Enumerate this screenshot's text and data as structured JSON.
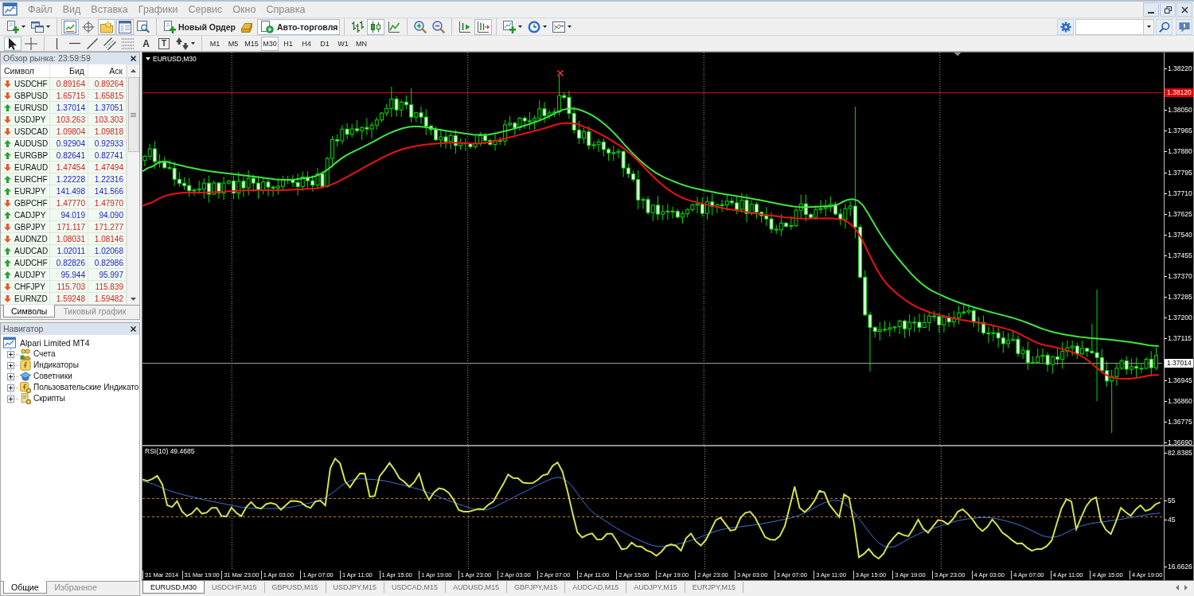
{
  "menu_bar": {
    "items": [
      "Файл",
      "Вид",
      "Вставка",
      "Графики",
      "Сервис",
      "Окно",
      "Справка"
    ]
  },
  "toolbar": {
    "groups": [
      [
        {
          "pressed": false,
          "dropdown": true
        },
        {
          "pressed": false,
          "dropdown": true
        }
      ],
      [
        {
          "pressed": true
        },
        {
          "pressed": false
        },
        {
          "pressed": true
        },
        {
          "pressed": true
        },
        {
          "pressed": false
        }
      ],
      [
        {
          "label": "Новый Ордер",
          "pressed": false
        },
        {
          "pressed": false
        },
        {
          "label": "Авто-торговля",
          "pressed": true
        }
      ],
      [
        {
          "pressed": false
        },
        {
          "pressed": true
        },
        {
          "pressed": false
        }
      ],
      [
        {
          "pressed": false
        },
        {
          "pressed": false
        }
      ],
      [
        {
          "pressed": false
        },
        {
          "pressed": true
        }
      ],
      [
        {
          "pressed": false,
          "dropdown": true
        },
        {
          "pressed": false,
          "dropdown": true
        },
        {
          "pressed": false,
          "dropdown": true
        }
      ]
    ]
  },
  "drawing_toolbar": {
    "groups": [
      [
        {
          "pressed": true
        },
        {
          "pressed": false
        }
      ],
      [
        {
          "pressed": false
        },
        {
          "pressed": false
        },
        {
          "pressed": false
        },
        {
          "pressed": false
        },
        {
          "pressed": false
        },
        {
          "label": "A",
          "pressed": false
        },
        {
          "label": "T",
          "pressed": false
        },
        {
          "pressed": false,
          "dropdown": true
        }
      ]
    ]
  },
  "periods": [
    {
      "label": "M1",
      "selected": false
    },
    {
      "label": "M5",
      "selected": false
    },
    {
      "label": "M15",
      "selected": false
    },
    {
      "label": "M30",
      "selected": true
    },
    {
      "label": "H1",
      "selected": false
    },
    {
      "label": "H4",
      "selected": false
    },
    {
      "label": "D1",
      "selected": false
    },
    {
      "label": "W1",
      "selected": false
    },
    {
      "label": "MN",
      "selected": false
    }
  ],
  "market_watch": {
    "title": "Обзор рынка: 23:59:59",
    "columns": [
      "Символ",
      "Бид",
      "Аск"
    ],
    "rows": [
      {
        "symbol": "USDCHF",
        "bid": "0.89164",
        "ask": "0.89264",
        "rising": false
      },
      {
        "symbol": "GBPUSD",
        "bid": "1.65715",
        "ask": "1.65815",
        "rising": false
      },
      {
        "symbol": "EURUSD",
        "bid": "1.37014",
        "ask": "1.37051",
        "rising": true
      },
      {
        "symbol": "USDJPY",
        "bid": "103.263",
        "ask": "103.303",
        "rising": false
      },
      {
        "symbol": "USDCAD",
        "bid": "1.09804",
        "ask": "1.09818",
        "rising": false
      },
      {
        "symbol": "AUDUSD",
        "bid": "0.92904",
        "ask": "0.92933",
        "rising": true
      },
      {
        "symbol": "EURGBP",
        "bid": "0.82641",
        "ask": "0.82741",
        "rising": true
      },
      {
        "symbol": "EURAUD",
        "bid": "1.47454",
        "ask": "1.47494",
        "rising": false
      },
      {
        "symbol": "EURCHF",
        "bid": "1.22228",
        "ask": "1.22316",
        "rising": true
      },
      {
        "symbol": "EURJPY",
        "bid": "141.498",
        "ask": "141.566",
        "rising": true
      },
      {
        "symbol": "GBPCHF",
        "bid": "1.47770",
        "ask": "1.47970",
        "rising": false
      },
      {
        "symbol": "CADJPY",
        "bid": "94.019",
        "ask": "94.090",
        "rising": true
      },
      {
        "symbol": "GBPJPY",
        "bid": "171.117",
        "ask": "171.277",
        "rising": false
      },
      {
        "symbol": "AUDNZD",
        "bid": "1.08031",
        "ask": "1.08146",
        "rising": false
      },
      {
        "symbol": "AUDCAD",
        "bid": "1.02011",
        "ask": "1.02068",
        "rising": true
      },
      {
        "symbol": "AUDCHF",
        "bid": "0.82826",
        "ask": "0.82986",
        "rising": true
      },
      {
        "symbol": "AUDJPY",
        "bid": "95.944",
        "ask": "95.997",
        "rising": true
      },
      {
        "symbol": "CHFJPY",
        "bid": "115.703",
        "ask": "115.839",
        "rising": false
      },
      {
        "symbol": "EURNZD",
        "bid": "1.59248",
        "ask": "1.59482",
        "rising": false
      }
    ],
    "tabs": [
      {
        "label": "Символы",
        "selected": true
      },
      {
        "label": "Тиковый график",
        "selected": false
      }
    ]
  },
  "navigator": {
    "title": "Навигатор",
    "tree": [
      {
        "label": "Alpari Limited MT4",
        "children": [
          {
            "label": "Счета",
            "expanded": false
          },
          {
            "label": "Индикаторы",
            "expanded": false
          },
          {
            "label": "Советники",
            "expanded": false
          },
          {
            "label": "Пользовательские Индикато",
            "expanded": false
          },
          {
            "label": "Скрипты",
            "expanded": false
          }
        ]
      }
    ],
    "tabs": [
      {
        "label": "Общие",
        "selected": true
      },
      {
        "label": "Избранное",
        "selected": false
      }
    ]
  },
  "chart": {
    "title": "EURUSD,M30",
    "price_axis": [
      "1.38220",
      "1.38050",
      "1.37965",
      "1.37880",
      "1.37795",
      "1.37710",
      "1.37625",
      "1.37540",
      "1.37455",
      "1.37370",
      "1.37285",
      "1.37200",
      "1.37115",
      "1.36945",
      "1.36860",
      "1.36775",
      "1.36690"
    ],
    "alert_price": "1.38120",
    "bid_price": "1.37014",
    "indicator": {
      "title": "RSI(10) 49.4685",
      "axis": [
        "82.8385",
        "55",
        "45",
        "16.6626"
      ]
    },
    "time_axis": [
      "31 Mar 2014",
      "31 Mar 19:00",
      "31 Mar 23:00",
      "1 Apr 03:00",
      "1 Apr 07:00",
      "1 Apr 11:00",
      "1 Apr 15:00",
      "1 Apr 19:00",
      "1 Apr 23:00",
      "2 Apr 03:00",
      "2 Apr 07:00",
      "2 Apr 11:00",
      "2 Apr 15:00",
      "2 Apr 19:00",
      "2 Apr 23:00",
      "3 Apr 03:00",
      "3 Apr 07:00",
      "3 Apr 11:00",
      "3 Apr 15:00",
      "3 Apr 19:00",
      "3 Apr 23:00",
      "4 Apr 03:00",
      "4 Apr 07:00",
      "4 Apr 11:00",
      "4 Apr 15:00",
      "4 Apr 19:00"
    ]
  },
  "chart_tabs": [
    {
      "label": "EURUSD,M30",
      "selected": true
    },
    {
      "label": "USDCHF,M15",
      "selected": false
    },
    {
      "label": "GBPUSD,M15",
      "selected": false
    },
    {
      "label": "USDJPY,M15",
      "selected": false
    },
    {
      "label": "USDCAD,M15",
      "selected": false
    },
    {
      "label": "AUDUSD,M15",
      "selected": false
    },
    {
      "label": "GBPJPY,M15",
      "selected": false
    },
    {
      "label": "AUDCAD,M15",
      "selected": false
    },
    {
      "label": "AUDJPY,M15",
      "selected": false
    },
    {
      "label": "EURJPY,M15",
      "selected": false
    }
  ]
}
